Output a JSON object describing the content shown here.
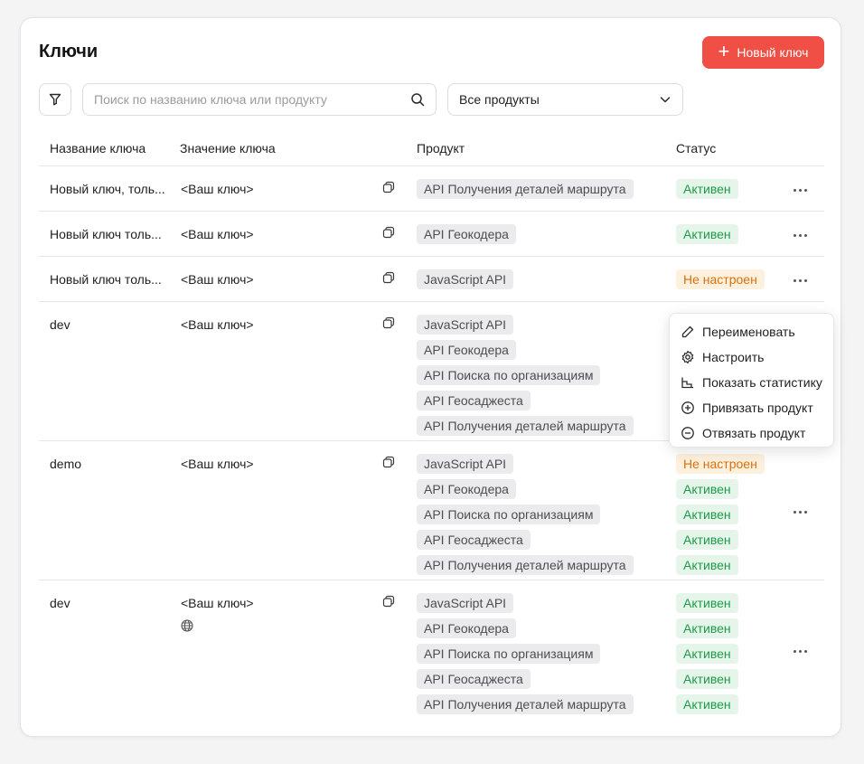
{
  "page": {
    "title": "Ключи",
    "new_key_label": "Новый ключ",
    "search_placeholder": "Поиск по названию ключа или продукту",
    "product_filter": "Все продукты"
  },
  "columns": {
    "name": "Название ключа",
    "value": "Значение ключа",
    "product": "Продукт",
    "status": "Статус"
  },
  "rows": [
    {
      "name": "Новый ключ, толь...",
      "value": "<Ваш ключ>",
      "products": [
        "API Получения деталей маршрута"
      ],
      "statuses": [
        "Активен"
      ]
    },
    {
      "name": "Новый ключ толь...",
      "value": "<Ваш ключ>",
      "products": [
        "API Геокодера"
      ],
      "statuses": [
        "Активен"
      ]
    },
    {
      "name": "Новый ключ толь...",
      "value": "<Ваш ключ>",
      "products": [
        "JavaScript API"
      ],
      "statuses": [
        "Не настроен"
      ]
    },
    {
      "name": "dev",
      "value": "<Ваш ключ>",
      "products": [
        "JavaScript API",
        "API Геокодера",
        "API Поиска по организациям",
        "API Геосаджеста",
        "API Получения деталей маршрута"
      ],
      "statuses": []
    },
    {
      "name": "demo",
      "value": "<Ваш ключ>",
      "products": [
        "JavaScript API",
        "API Геокодера",
        "API Поиска по организациям",
        "API Геосаджеста",
        "API Получения деталей маршрута"
      ],
      "statuses": [
        "Не настроен",
        "Активен",
        "Активен",
        "Активен",
        "Активен"
      ]
    },
    {
      "name": "dev",
      "value": "<Ваш ключ>",
      "products": [
        "JavaScript API",
        "API Геокодера",
        "API Поиска по организациям",
        "API Геосаджеста",
        "API Получения деталей маршрута"
      ],
      "statuses": [
        "Активен",
        "Активен",
        "Активен",
        "Активен",
        "Активен"
      ]
    }
  ],
  "context_menu": {
    "rename": "Переименовать",
    "configure": "Настроить",
    "show_stats": "Показать статистику",
    "attach_product": "Привязать продукт",
    "detach_product": "Отвязать продукт"
  },
  "colors": {
    "accent": "#ef4f45",
    "active_bg": "#e6f5ea",
    "active_fg": "#1e9a4b",
    "notset_bg": "#fdf0dc",
    "notset_fg": "#d9700e"
  }
}
